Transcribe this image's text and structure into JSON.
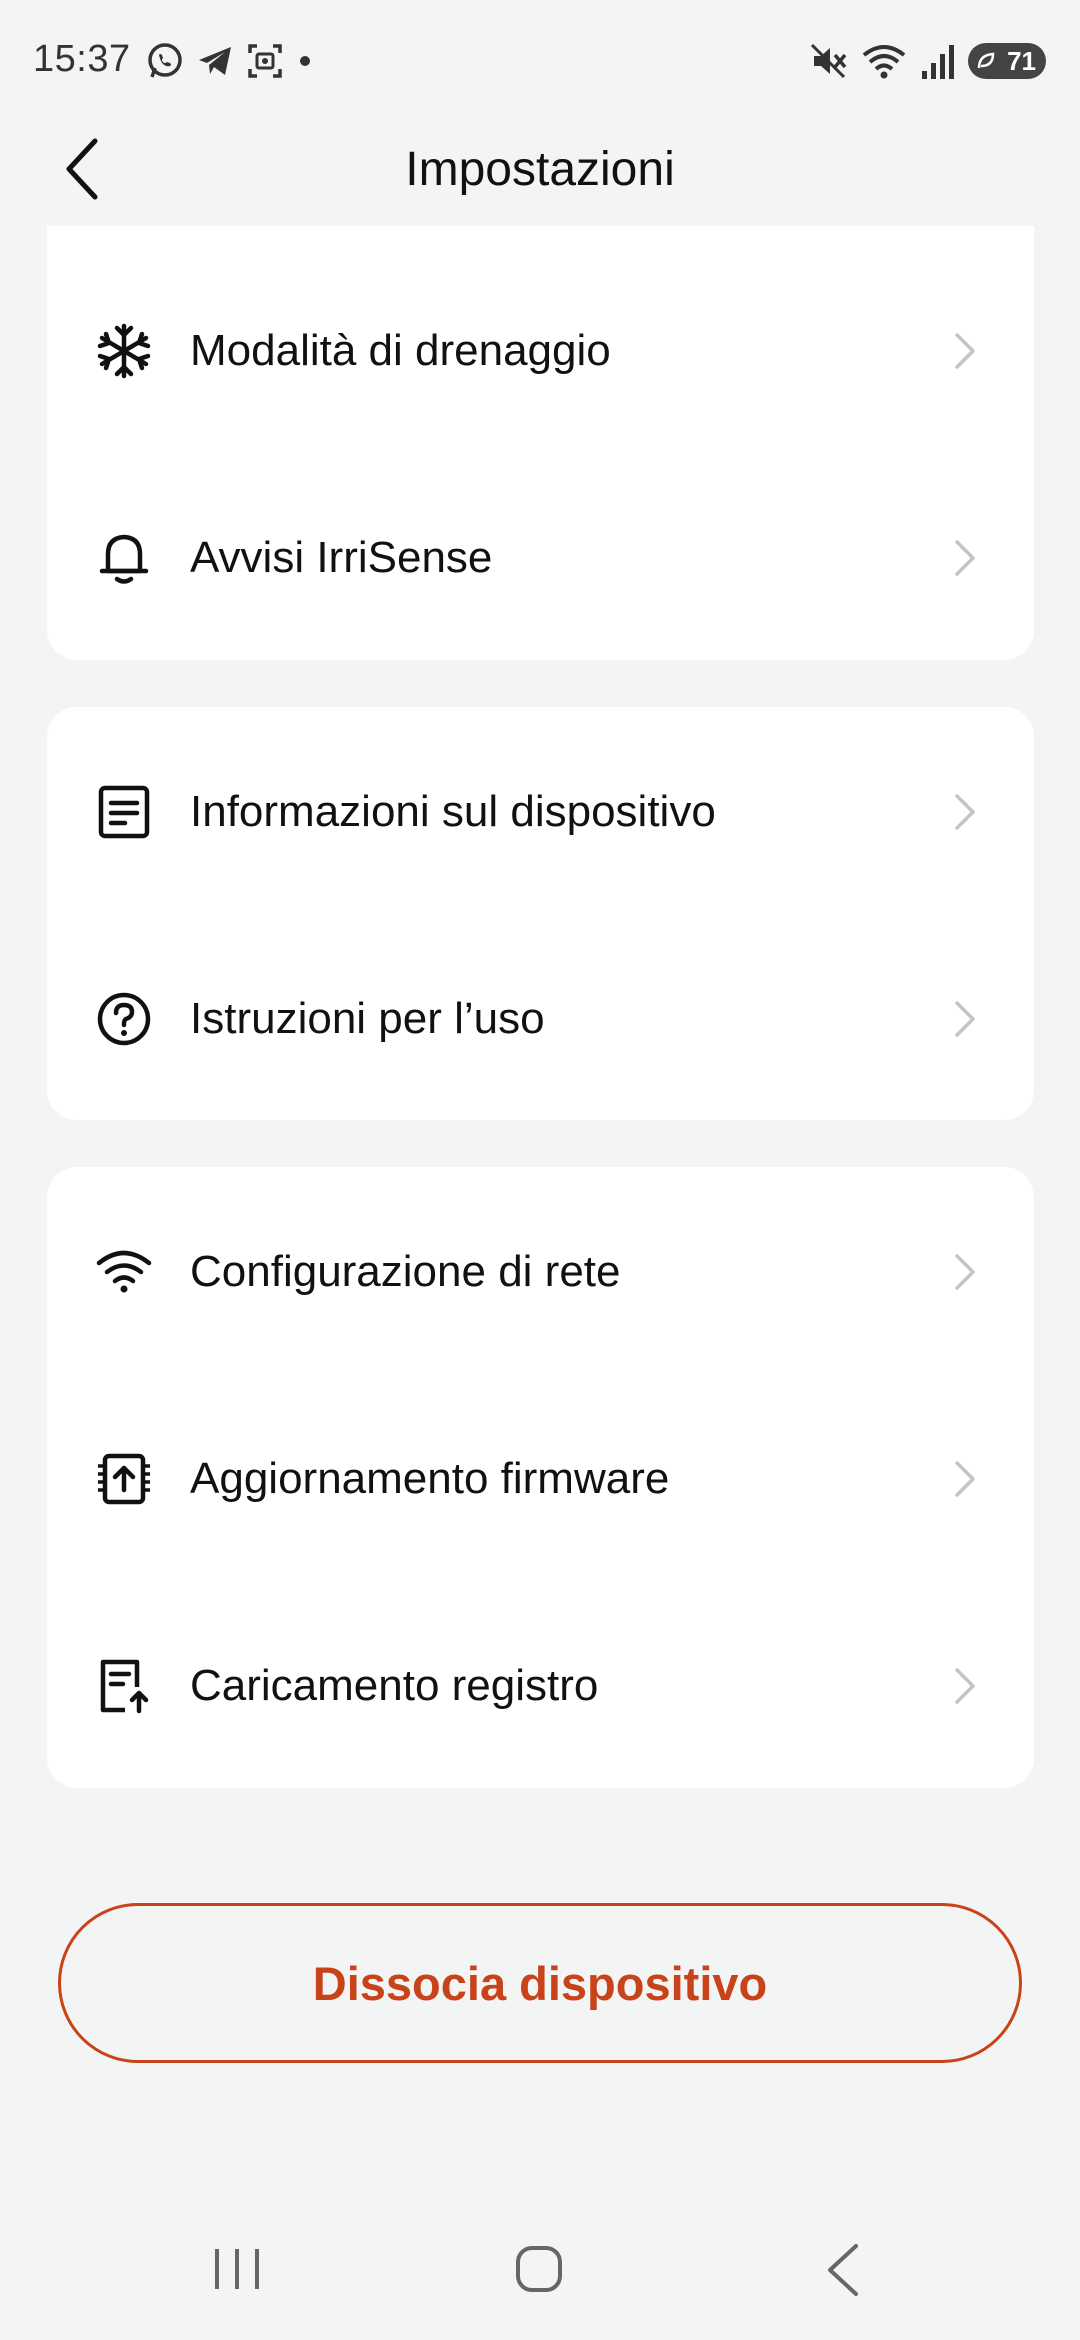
{
  "status_bar": {
    "time": "15:37",
    "battery": "71",
    "left_icons": [
      "whatsapp-icon",
      "telegram-icon",
      "screenshot-icon",
      "dot-icon"
    ],
    "right_icons": [
      "mute-icon",
      "wifi-icon",
      "signal-icon",
      "battery-icon"
    ]
  },
  "header": {
    "title": "Impostazioni"
  },
  "sections": [
    {
      "items": [
        {
          "label": "Modalità di drenaggio",
          "icon": "snowflake-icon"
        },
        {
          "label": "Avvisi IrriSense",
          "icon": "bell-icon"
        }
      ]
    },
    {
      "items": [
        {
          "label": "Informazioni sul dispositivo",
          "icon": "info-document-icon"
        },
        {
          "label": "Istruzioni per l’uso",
          "icon": "help-circle-icon"
        }
      ]
    },
    {
      "items": [
        {
          "label": "Configurazione di rete",
          "icon": "wifi-icon"
        },
        {
          "label": "Aggiornamento firmware",
          "icon": "firmware-upload-icon"
        },
        {
          "label": "Caricamento registro",
          "icon": "log-upload-icon"
        }
      ]
    }
  ],
  "unbind_button": {
    "label": "Dissocia dispositivo"
  },
  "colors": {
    "accent": "#c9431a",
    "background": "#f3f4f4",
    "card": "#ffffff",
    "chevron": "#c4c4c4"
  }
}
